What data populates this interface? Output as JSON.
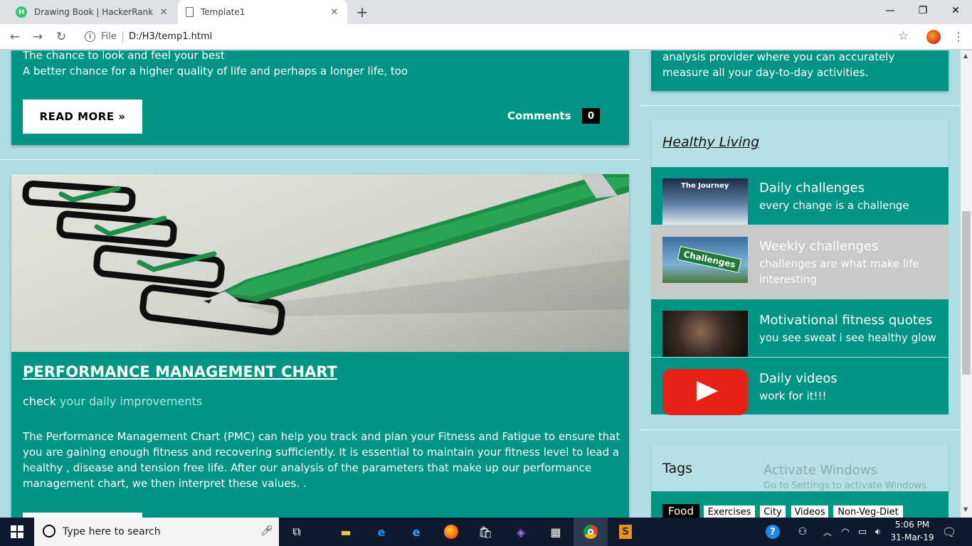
{
  "browser": {
    "tabs": [
      {
        "title": "Drawing Book | HackerRank",
        "active": false
      },
      {
        "title": "Template1",
        "active": true
      }
    ],
    "url_scheme": "File",
    "url": "D:/H3/temp1.html"
  },
  "top_post": {
    "lines": [
      "The chance to look and feel your best",
      "A better chance for a higher quality of life and perhaps a longer life, too"
    ],
    "read_more": "READ MORE »",
    "comments_label": "Comments",
    "comments_count": "0"
  },
  "post": {
    "title": "PERFORMANCE MANAGEMENT CHART",
    "subtitle_lead": "check",
    "subtitle_rest": " your daily improvements",
    "body": "The Performance Management Chart (PMC) can help you track and plan your Fitness and Fatigue to ensure that you are gaining enough fitness and recovering sufficiently. It is essential to maintain your fitness level to lead a healthy , disease and tension free life. After our analysis of the parameters that make up our performance management chart, we then interpret these values. ."
  },
  "sidebar": {
    "about_lines": [
      "analysis provider where you can accurately",
      "measure all your day-to-day activities."
    ],
    "healthy_title": "Healthy Living",
    "items": [
      {
        "title": "Daily challenges",
        "desc": "every change is a challenge",
        "thumb_text": "The Journey",
        "highlight": false
      },
      {
        "title": "Weekly challenges",
        "desc": "challenges are what make life interesting",
        "thumb_text": "Challenges",
        "highlight": true
      },
      {
        "title": "Motivational fitness quotes",
        "desc": "you see sweat i see healthy glow",
        "thumb_text": "",
        "highlight": false
      },
      {
        "title": "Daily videos",
        "desc": "work for it!!!",
        "thumb_text": "",
        "highlight": false
      }
    ],
    "tags_title": "Tags",
    "tags": [
      "Food",
      "Exercises",
      "City",
      "Videos",
      "Non-Veg-Diet"
    ],
    "watermark_title": "Activate Windows",
    "watermark_sub": "Go to Settings to activate Windows."
  },
  "taskbar": {
    "search_placeholder": "Type here to search",
    "time": "5:06 PM",
    "date": "31-Mar-19"
  },
  "colors": {
    "teal": "#009485",
    "page_bg": "#b0dde4",
    "highlight": "#c9c9c9"
  }
}
